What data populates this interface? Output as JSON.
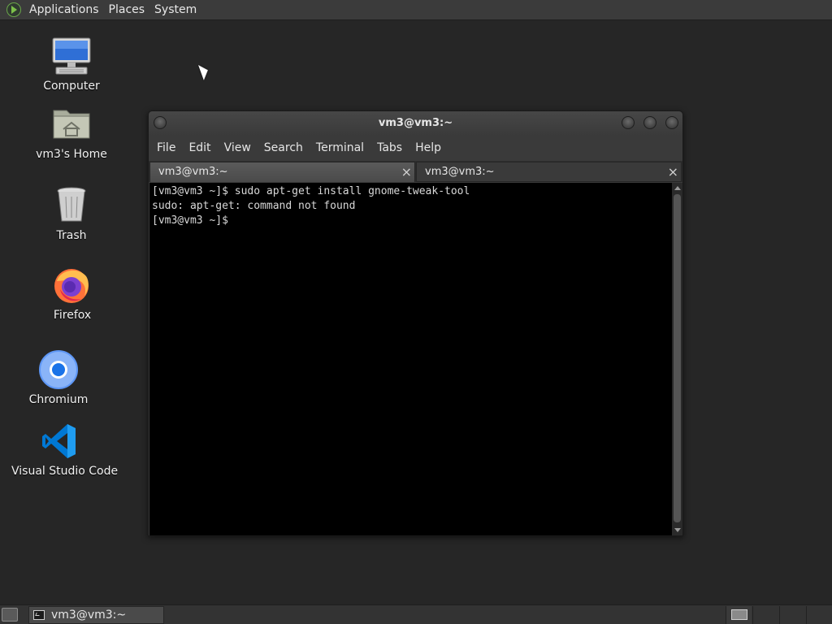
{
  "top_panel": {
    "menus": [
      "Applications",
      "Places",
      "System"
    ],
    "logo_icon": "gnome-foot-icon"
  },
  "desktop_icons": [
    {
      "label": "Computer",
      "icon": "computer-icon"
    },
    {
      "label": "vm3's Home",
      "icon": "home-folder-icon"
    },
    {
      "label": "Trash",
      "icon": "trash-icon"
    },
    {
      "label": "Firefox",
      "icon": "firefox-icon"
    },
    {
      "label": "Chromium",
      "icon": "chromium-icon"
    },
    {
      "label": "Visual Studio Code",
      "icon": "vscode-icon"
    }
  ],
  "terminal": {
    "title": "vm3@vm3:~",
    "menu": [
      "File",
      "Edit",
      "View",
      "Search",
      "Terminal",
      "Tabs",
      "Help"
    ],
    "tabs": [
      {
        "label": "vm3@vm3:~",
        "close": "×"
      },
      {
        "label": "vm3@vm3:~",
        "close": "×"
      }
    ],
    "lines": [
      "[vm3@vm3 ~]$ sudo apt-get install gnome-tweak-tool",
      "sudo: apt-get: command not found",
      "[vm3@vm3 ~]$"
    ]
  },
  "bottom_panel": {
    "task_label": "vm3@vm3:~"
  },
  "colors": {
    "desktop_bg": "#262626",
    "panel_bg": "#3b3b3b",
    "terminal_bg": "#000000",
    "terminal_fg": "#d8d8d8"
  }
}
